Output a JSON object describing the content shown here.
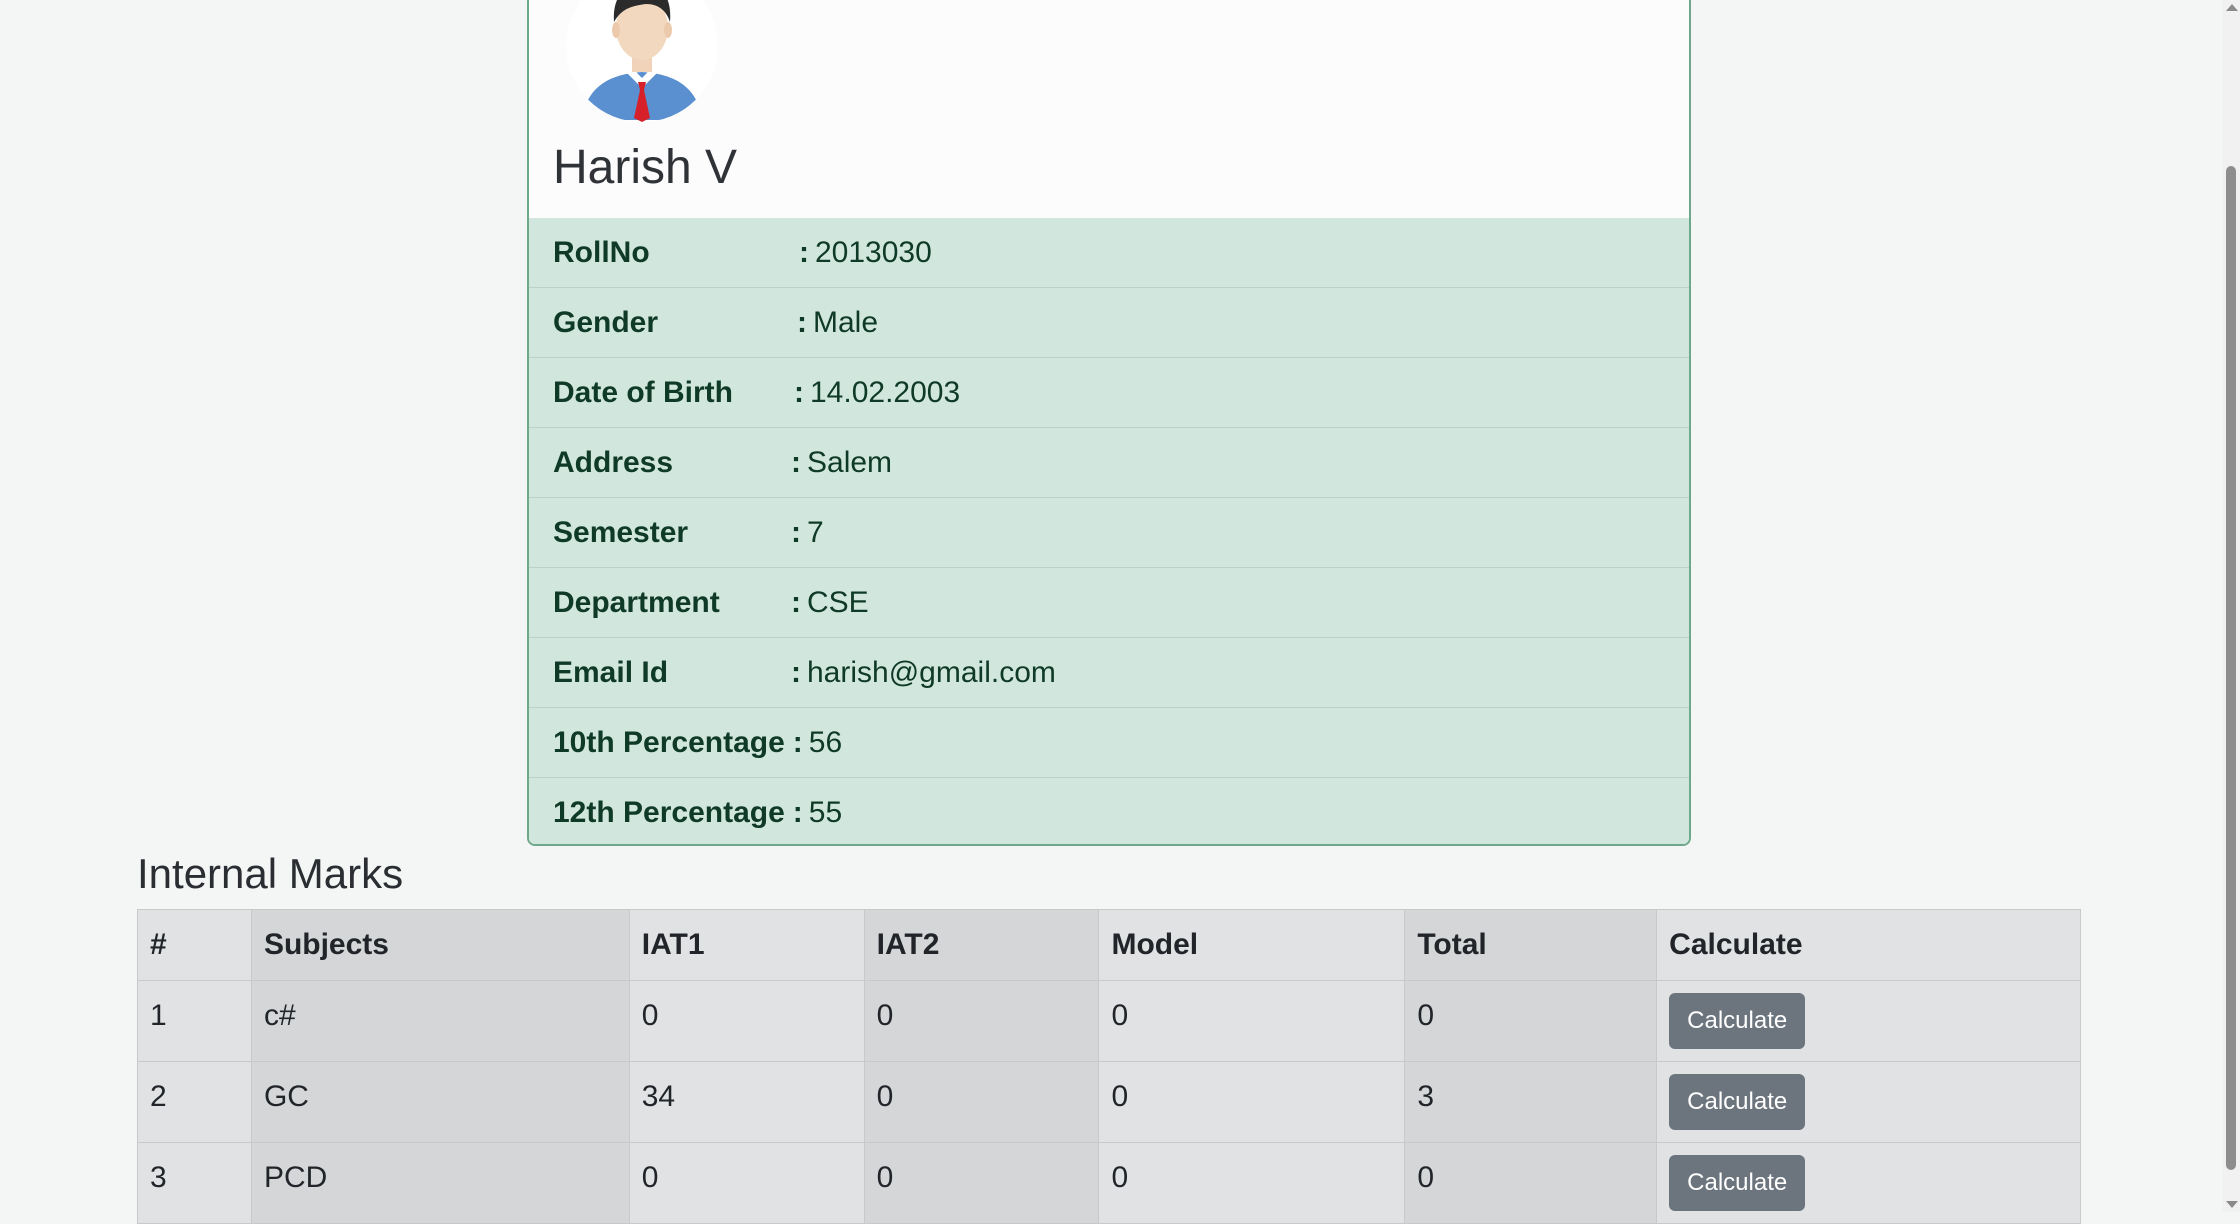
{
  "profile": {
    "name": "Harish V",
    "avatar_icon": "male-student-avatar-icon",
    "details": [
      {
        "label": "RollNo",
        "sep": ":",
        "value": "2013030"
      },
      {
        "label": "Gender",
        "sep": ":",
        "value": "Male"
      },
      {
        "label": "Date of Birth",
        "sep": ":",
        "value": "14.02.2003"
      },
      {
        "label": "Address",
        "sep": ":",
        "value": "Salem"
      },
      {
        "label": "Semester",
        "sep": ":",
        "value": "7"
      },
      {
        "label": "Department",
        "sep": ":",
        "value": "CSE"
      },
      {
        "label": "Email Id",
        "sep": ":",
        "value": "harish@gmail.com"
      },
      {
        "label": "10th Percentage",
        "sep": ":",
        "value": "56"
      },
      {
        "label": "12th Percentage",
        "sep": ":",
        "value": "55"
      }
    ]
  },
  "marks": {
    "title": "Internal Marks",
    "columns": [
      "#",
      "Subjects",
      "IAT1",
      "IAT2",
      "Model",
      "Total",
      "Calculate"
    ],
    "rows": [
      {
        "no": "1",
        "subject": "c#",
        "iat1": "0",
        "iat2": "0",
        "model": "0",
        "total": "0",
        "button": "Calculate"
      },
      {
        "no": "2",
        "subject": "GC",
        "iat1": "34",
        "iat2": "0",
        "model": "0",
        "total": "3",
        "button": "Calculate"
      },
      {
        "no": "3",
        "subject": "PCD",
        "iat1": "0",
        "iat2": "0",
        "model": "0",
        "total": "0",
        "button": "Calculate"
      }
    ]
  },
  "colors": {
    "details_bg": "#d1e7dd",
    "card_border": "#6ea88a",
    "button_bg": "#6c757d",
    "table_bg": "#e1e2e4"
  }
}
